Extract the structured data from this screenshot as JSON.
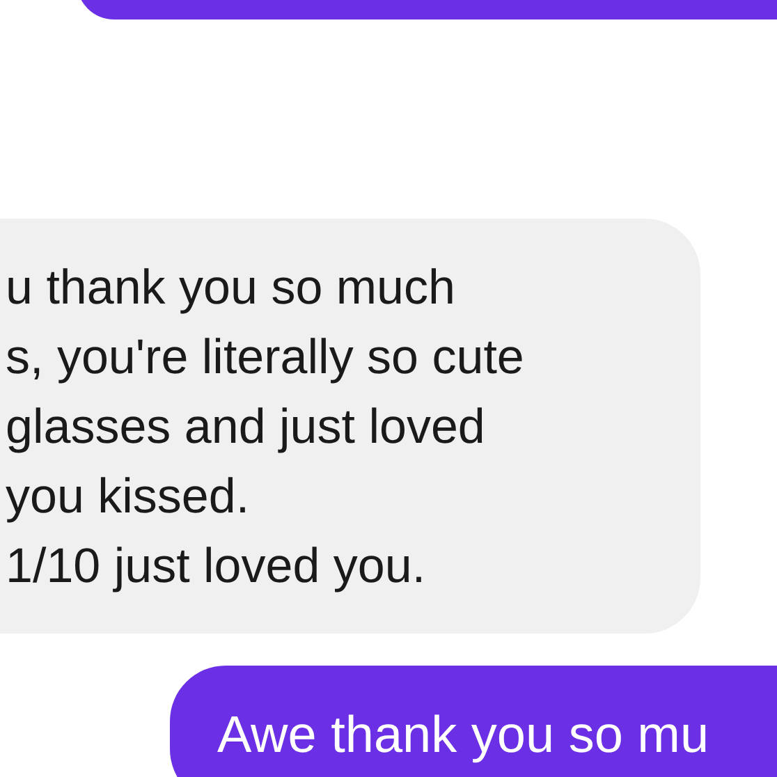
{
  "messages": [
    {
      "kind": "sent"
    },
    {
      "kind": "received",
      "lines": [
        "u thank you so much",
        "s, you're literally so cute",
        "glasses and just loved",
        "you kissed.",
        "1/10 just loved you."
      ]
    },
    {
      "kind": "sent",
      "lines": [
        "Awe thank you so mu"
      ]
    }
  ]
}
